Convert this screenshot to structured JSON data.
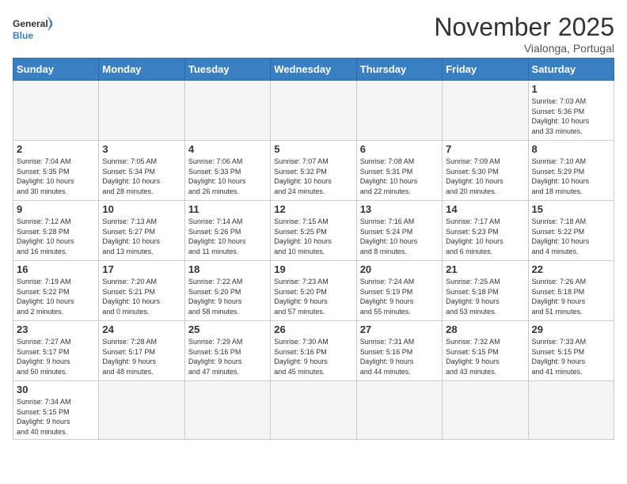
{
  "header": {
    "logo_general": "General",
    "logo_blue": "Blue",
    "month_title": "November 2025",
    "location": "Vialonga, Portugal"
  },
  "days_of_week": [
    "Sunday",
    "Monday",
    "Tuesday",
    "Wednesday",
    "Thursday",
    "Friday",
    "Saturday"
  ],
  "weeks": [
    [
      {
        "day": "",
        "info": ""
      },
      {
        "day": "",
        "info": ""
      },
      {
        "day": "",
        "info": ""
      },
      {
        "day": "",
        "info": ""
      },
      {
        "day": "",
        "info": ""
      },
      {
        "day": "",
        "info": ""
      },
      {
        "day": "1",
        "info": "Sunrise: 7:03 AM\nSunset: 5:36 PM\nDaylight: 10 hours\nand 33 minutes."
      }
    ],
    [
      {
        "day": "2",
        "info": "Sunrise: 7:04 AM\nSunset: 5:35 PM\nDaylight: 10 hours\nand 30 minutes."
      },
      {
        "day": "3",
        "info": "Sunrise: 7:05 AM\nSunset: 5:34 PM\nDaylight: 10 hours\nand 28 minutes."
      },
      {
        "day": "4",
        "info": "Sunrise: 7:06 AM\nSunset: 5:33 PM\nDaylight: 10 hours\nand 26 minutes."
      },
      {
        "day": "5",
        "info": "Sunrise: 7:07 AM\nSunset: 5:32 PM\nDaylight: 10 hours\nand 24 minutes."
      },
      {
        "day": "6",
        "info": "Sunrise: 7:08 AM\nSunset: 5:31 PM\nDaylight: 10 hours\nand 22 minutes."
      },
      {
        "day": "7",
        "info": "Sunrise: 7:09 AM\nSunset: 5:30 PM\nDaylight: 10 hours\nand 20 minutes."
      },
      {
        "day": "8",
        "info": "Sunrise: 7:10 AM\nSunset: 5:29 PM\nDaylight: 10 hours\nand 18 minutes."
      }
    ],
    [
      {
        "day": "9",
        "info": "Sunrise: 7:12 AM\nSunset: 5:28 PM\nDaylight: 10 hours\nand 16 minutes."
      },
      {
        "day": "10",
        "info": "Sunrise: 7:13 AM\nSunset: 5:27 PM\nDaylight: 10 hours\nand 13 minutes."
      },
      {
        "day": "11",
        "info": "Sunrise: 7:14 AM\nSunset: 5:26 PM\nDaylight: 10 hours\nand 11 minutes."
      },
      {
        "day": "12",
        "info": "Sunrise: 7:15 AM\nSunset: 5:25 PM\nDaylight: 10 hours\nand 10 minutes."
      },
      {
        "day": "13",
        "info": "Sunrise: 7:16 AM\nSunset: 5:24 PM\nDaylight: 10 hours\nand 8 minutes."
      },
      {
        "day": "14",
        "info": "Sunrise: 7:17 AM\nSunset: 5:23 PM\nDaylight: 10 hours\nand 6 minutes."
      },
      {
        "day": "15",
        "info": "Sunrise: 7:18 AM\nSunset: 5:22 PM\nDaylight: 10 hours\nand 4 minutes."
      }
    ],
    [
      {
        "day": "16",
        "info": "Sunrise: 7:19 AM\nSunset: 5:22 PM\nDaylight: 10 hours\nand 2 minutes."
      },
      {
        "day": "17",
        "info": "Sunrise: 7:20 AM\nSunset: 5:21 PM\nDaylight: 10 hours\nand 0 minutes."
      },
      {
        "day": "18",
        "info": "Sunrise: 7:22 AM\nSunset: 5:20 PM\nDaylight: 9 hours\nand 58 minutes."
      },
      {
        "day": "19",
        "info": "Sunrise: 7:23 AM\nSunset: 5:20 PM\nDaylight: 9 hours\nand 57 minutes."
      },
      {
        "day": "20",
        "info": "Sunrise: 7:24 AM\nSunset: 5:19 PM\nDaylight: 9 hours\nand 55 minutes."
      },
      {
        "day": "21",
        "info": "Sunrise: 7:25 AM\nSunset: 5:18 PM\nDaylight: 9 hours\nand 53 minutes."
      },
      {
        "day": "22",
        "info": "Sunrise: 7:26 AM\nSunset: 5:18 PM\nDaylight: 9 hours\nand 51 minutes."
      }
    ],
    [
      {
        "day": "23",
        "info": "Sunrise: 7:27 AM\nSunset: 5:17 PM\nDaylight: 9 hours\nand 50 minutes."
      },
      {
        "day": "24",
        "info": "Sunrise: 7:28 AM\nSunset: 5:17 PM\nDaylight: 9 hours\nand 48 minutes."
      },
      {
        "day": "25",
        "info": "Sunrise: 7:29 AM\nSunset: 5:16 PM\nDaylight: 9 hours\nand 47 minutes."
      },
      {
        "day": "26",
        "info": "Sunrise: 7:30 AM\nSunset: 5:16 PM\nDaylight: 9 hours\nand 45 minutes."
      },
      {
        "day": "27",
        "info": "Sunrise: 7:31 AM\nSunset: 5:16 PM\nDaylight: 9 hours\nand 44 minutes."
      },
      {
        "day": "28",
        "info": "Sunrise: 7:32 AM\nSunset: 5:15 PM\nDaylight: 9 hours\nand 43 minutes."
      },
      {
        "day": "29",
        "info": "Sunrise: 7:33 AM\nSunset: 5:15 PM\nDaylight: 9 hours\nand 41 minutes."
      }
    ],
    [
      {
        "day": "30",
        "info": "Sunrise: 7:34 AM\nSunset: 5:15 PM\nDaylight: 9 hours\nand 40 minutes."
      },
      {
        "day": "",
        "info": ""
      },
      {
        "day": "",
        "info": ""
      },
      {
        "day": "",
        "info": ""
      },
      {
        "day": "",
        "info": ""
      },
      {
        "day": "",
        "info": ""
      },
      {
        "day": "",
        "info": ""
      }
    ]
  ]
}
